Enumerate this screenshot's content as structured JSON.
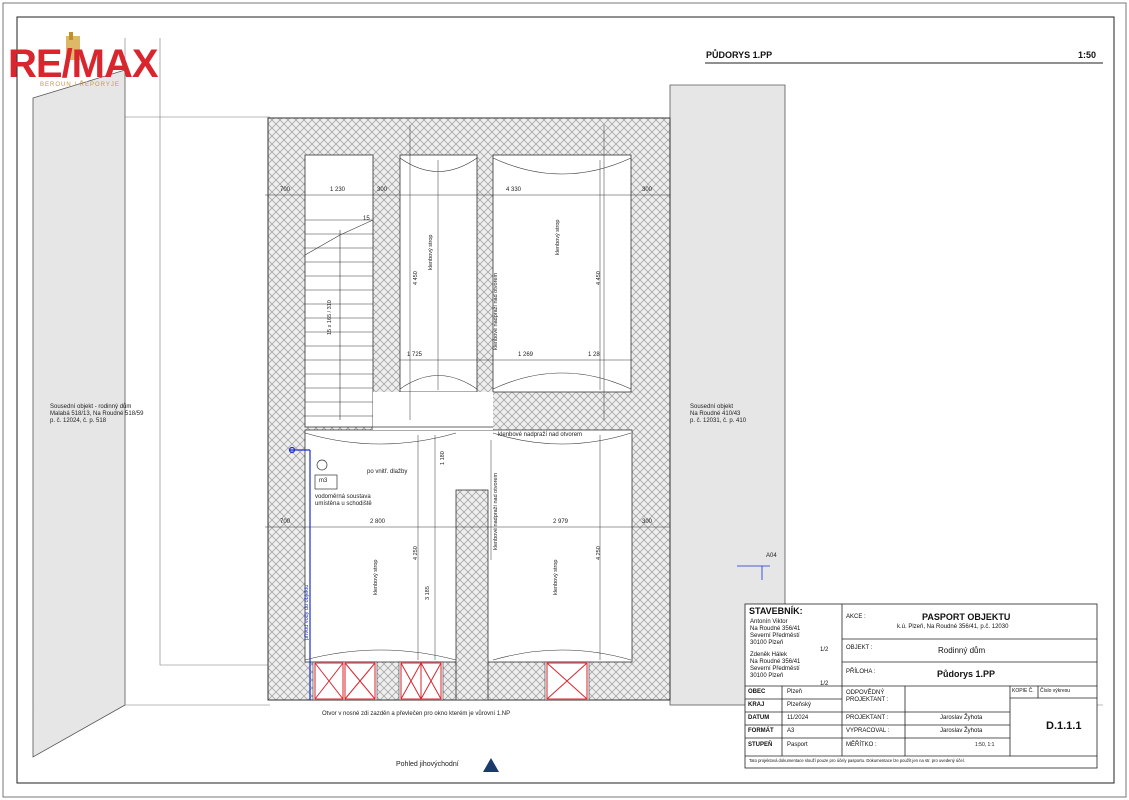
{
  "logo": {
    "brand": "RE/MAX",
    "tagline": "BEROUN / ŘEPORYJE"
  },
  "header": {
    "title": "PŮDORYS 1.PP",
    "scale": "1:50"
  },
  "neighbors": {
    "left": [
      "Sousední objekt - rodinný dům",
      "Malabá 518/13, Na Roudné 518/59",
      "p. č. 12024, č. p. 518"
    ],
    "right": [
      "Sousední objekt",
      "Na Roudné 410/43",
      "p. č. 12031, č. p. 410"
    ]
  },
  "dimensions": {
    "top": [
      "700",
      "1 230",
      "300",
      "4 330",
      "300"
    ],
    "bottom": [
      "700",
      "2 800",
      "2 979",
      "300"
    ],
    "middle": [
      "1 725",
      "1 269",
      "1 28"
    ],
    "vertical": [
      "4 450",
      "4 450",
      "4 250",
      "4 250",
      "3 185",
      "1 180"
    ],
    "stair_count": "15"
  },
  "room_labels": {
    "ceiling": "klenbový strop",
    "opening_1": "klenbové nadpraží nad otvorem",
    "opening_2": "klenbové nadpraží nad otvorem",
    "floor_note": "po vnitř. dlažby",
    "meter": "m3",
    "water_note_1": "vodoměrná soustava",
    "water_note_2": "umístěna u schodiště",
    "water_pipe": "přívod vody do objektu",
    "stair_note": "15 x 165 / 310"
  },
  "notes": {
    "bottom_note": "Otvor v nosné zdi zazděn a převlečen pro okno kterém je vůrovní 1.NP",
    "view": "Pohled jihovýchodní",
    "marker": "A04"
  },
  "title_block": {
    "investor_label": "STAVEBNÍK:",
    "investor_lines": [
      "Antonín Viktor",
      "Na Roudné 356/41",
      "Severní Předměstí",
      "30100 Plzeň"
    ],
    "share_1": "1/2",
    "investor2_lines": [
      "Zdeněk Hálek",
      "Na Roudné 356/41",
      "Severní Předměstí",
      "30100 Plzeň"
    ],
    "share_2": "1/2",
    "akce_label": "AKCE :",
    "akce_title": "PASPORT OBJEKTU",
    "akce_sub": "k.ú. Plzeň, Na Roudné 356/41, p.č. 12030",
    "objekt_label": "OBJEKT :",
    "objekt_value": "Rodinný dům",
    "priloha_label": "PŘÍLOHA :",
    "priloha_value": "Půdorys 1.PP",
    "obec_label": "OBEC",
    "obec_value": "Plzeň",
    "kraj_label": "KRAJ",
    "kraj_value": "Plzeňský",
    "datum_label": "DATUM",
    "datum_value": "11/2024",
    "format_label": "FORMÁT",
    "format_value": "A3",
    "stupen_label": "STUPEŇ",
    "stupen_value": "Pasport",
    "odpovedny_label": "ODPOVĚDNÝ PROJEKTANT :",
    "projektant_label": "PROJEKTANT :",
    "projektant_value": "Jaroslav Žyhota",
    "vypracoval_label": "VYPRACOVAL :",
    "vypracoval_value": "Jaroslav Žyhota",
    "meritko_label": "MĚŘÍTKO :",
    "meritko_value": "1:50, 1:1",
    "kopie_label": "KOPIE Č.",
    "cislo_label": "Číslo výkresu",
    "cislo_value": "D.1.1.1",
    "footer": "Tato projektová dokumentace slouží pouze pro účely pasportu. Dokumentace lze použít jen na str. pro uvedený účel."
  }
}
